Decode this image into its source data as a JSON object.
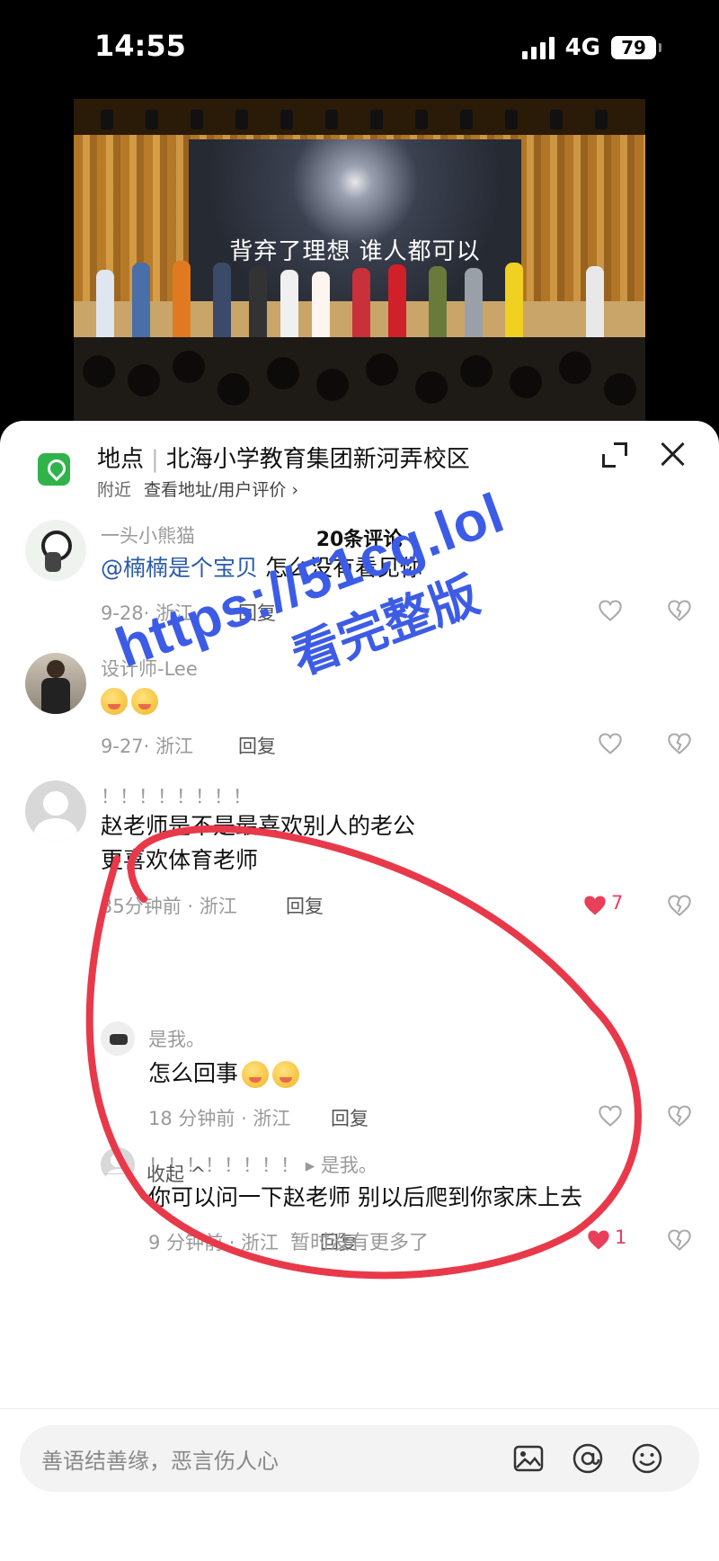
{
  "status_bar": {
    "time": "14:55",
    "network": "4G",
    "battery": "79"
  },
  "video": {
    "screen_caption": "背弃了理想 谁人都可以"
  },
  "location": {
    "label": "地点",
    "name": "北海小学教育集团新河弄校区",
    "nearby": "附近",
    "view_link": "查看地址/用户评价 ›"
  },
  "comments_header": {
    "count": "20条评论"
  },
  "comments": [
    {
      "username": "一头小熊猫",
      "mention": "@楠楠是个宝贝",
      "text": " 怎么没有看见你",
      "meta": "9-28· 浙江",
      "reply": "回复",
      "likes": ""
    },
    {
      "username": "设计师-Lee",
      "meta": "9-27· 浙江",
      "reply": "回复",
      "likes": ""
    },
    {
      "username": "！！！！！！！！",
      "text_line1": "赵老师是不是最喜欢别人的老公",
      "text_line2": "更喜欢体育老师",
      "meta": "35分钟前 · 浙江",
      "reply": "回复",
      "likes": "7"
    }
  ],
  "replies": [
    {
      "username": "是我。",
      "text": "怎么回事",
      "meta": "18 分钟前 · 浙江",
      "reply": "回复",
      "likes": ""
    },
    {
      "username": "！！！！！！！！",
      "reply_to": "▸ 是我。",
      "text": "你可以问一下赵老师  别以后爬到你家床上去",
      "meta": "9 分钟前 · 浙江",
      "reply": "回复",
      "likes": "1"
    }
  ],
  "collapse_label": "收起 ^",
  "no_more": "暂时没有更多了",
  "input": {
    "placeholder": "善语结善缘，恶言伤人心"
  },
  "watermark": {
    "url": "https://51cg.lol",
    "cta": "看完整版"
  },
  "colors": {
    "accent_red": "#e8405a",
    "mention_blue": "#2a5aa8",
    "watermark_blue": "#3d5ce6",
    "annotation_red": "#e8394a"
  },
  "icons": [
    "location-pin-icon",
    "expand-icon",
    "close-icon",
    "heart-icon",
    "dislike-heart-icon",
    "image-icon",
    "at-icon",
    "emoji-icon"
  ]
}
